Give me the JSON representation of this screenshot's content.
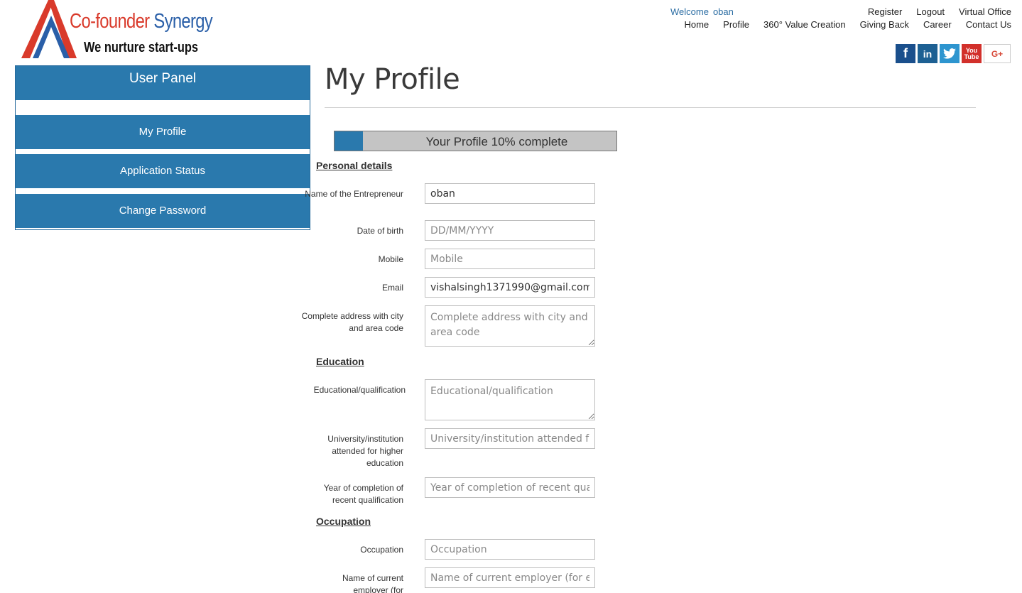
{
  "brand": {
    "name_part1": "Co-founder",
    "name_part2": "Synergy",
    "tagline": "We nurture start-ups"
  },
  "header": {
    "welcome_label": "Welcome",
    "username": "oban",
    "nav_row1": [
      "Register",
      "Logout",
      "Virtual Office"
    ],
    "nav_row2": [
      "Home",
      "Profile",
      "360° Value Creation",
      "Giving Back",
      "Career",
      "Contact Us"
    ]
  },
  "social": {
    "facebook": "f",
    "linkedin": "in",
    "twitter": "t",
    "youtube_top": "You",
    "youtube_bottom": "Tube",
    "googleplus": "G+"
  },
  "sidebar": {
    "title": "User Panel",
    "items": [
      "My Profile",
      "Application Status",
      "Change Password"
    ]
  },
  "main": {
    "title": "My Profile",
    "progress": {
      "text": "Your Profile 10% complete",
      "percent": 10
    },
    "sections": {
      "personal": "Personal details",
      "education": "Education",
      "occupation": "Occupation"
    },
    "fields": {
      "name": {
        "label": "Name of the Entrepreneur",
        "value": "oban",
        "placeholder": ""
      },
      "dob": {
        "label": "Date of birth",
        "value": "",
        "placeholder": "DD/MM/YYYY"
      },
      "mobile": {
        "label": "Mobile",
        "value": "",
        "placeholder": "Mobile"
      },
      "email": {
        "label": "Email",
        "value": "vishalsingh1371990@gmail.com",
        "placeholder": ""
      },
      "address": {
        "label": "Complete address with city and area code",
        "value": "",
        "placeholder": "Complete address with city and area code"
      },
      "education": {
        "label": "Educational/qualification",
        "value": "",
        "placeholder": "Educational/qualification"
      },
      "university": {
        "label": "University/institution attended for higher education",
        "value": "",
        "placeholder": "University/institution attended for higher education"
      },
      "year": {
        "label": "Year of completion of recent qualification",
        "value": "",
        "placeholder": "Year of completion of recent qualification"
      },
      "occupation": {
        "label": "Occupation",
        "value": "",
        "placeholder": "Occupation"
      },
      "employer": {
        "label": "Name of current employer (for",
        "value": "",
        "placeholder": "Name of current employer (for employed)"
      }
    }
  },
  "colors": {
    "brand_red": "#d93a2b",
    "brand_blue": "#2a5fa8",
    "panel_blue": "#2a79ad"
  }
}
